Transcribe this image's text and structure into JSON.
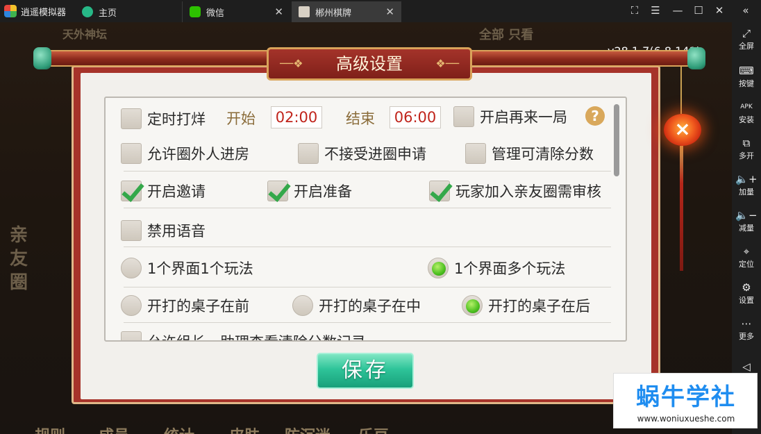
{
  "titlebar": {
    "app_name": "逍遥模拟器",
    "tabs": [
      {
        "label": "主页"
      },
      {
        "label": "微信"
      },
      {
        "label": "郴州棋牌"
      }
    ]
  },
  "sidebar": {
    "items": [
      {
        "label": "全屏",
        "icon": "fullscreen-icon"
      },
      {
        "label": "按键",
        "icon": "keyboard-icon"
      },
      {
        "label": "安装",
        "icon": "apk-icon"
      },
      {
        "label": "多开",
        "icon": "multi-instance-icon"
      },
      {
        "label": "加量",
        "icon": "volume-up-icon"
      },
      {
        "label": "减量",
        "icon": "volume-down-icon"
      },
      {
        "label": "定位",
        "icon": "location-icon"
      },
      {
        "label": "设置",
        "icon": "gear-icon"
      },
      {
        "label": "更多",
        "icon": "more-icon"
      }
    ]
  },
  "game": {
    "version": "v28.1.7(6.8.141)",
    "bottom_nav": [
      "规则",
      "成员",
      "统计",
      "皮肤",
      "防沉迷",
      "乐豆"
    ]
  },
  "dialog": {
    "title": "高级设置",
    "timer": {
      "label": "定时打烊",
      "start_label": "开始",
      "start_value": "02:00",
      "end_label": "结束",
      "end_value": "06:00"
    },
    "help_symbol": "?",
    "close_symbol": "×",
    "checkboxes": {
      "timer": {
        "checked": false
      },
      "replay": {
        "label": "开启再来一局",
        "checked": false
      },
      "allow_outsiders": {
        "label": "允许圈外人进房",
        "checked": false
      },
      "reject_join": {
        "label": "不接受进圈申请",
        "checked": false
      },
      "admin_clear": {
        "label": "管理可清除分数",
        "checked": false
      },
      "invite": {
        "label": "开启邀请",
        "checked": true
      },
      "ready": {
        "label": "开启准备",
        "checked": true
      },
      "join_review": {
        "label": "玩家加入亲友圈需审核",
        "checked": true
      },
      "mute_voice": {
        "label": "禁用语音",
        "checked": false
      },
      "leader_view": {
        "label": "允许组长、助理查看清除分数记录",
        "checked": false
      }
    },
    "layout_mode": {
      "options": [
        "1个界面1个玩法",
        "1个界面多个玩法"
      ],
      "selected": "1个界面多个玩法"
    },
    "table_order": {
      "options": [
        "开打的桌子在前",
        "开打的桌子在中",
        "开打的桌子在后"
      ],
      "selected": "开打的桌子在后"
    },
    "save_label": "保存"
  },
  "watermark": {
    "brand": "蜗牛学社",
    "url": "www.woniuxueshe.com"
  }
}
